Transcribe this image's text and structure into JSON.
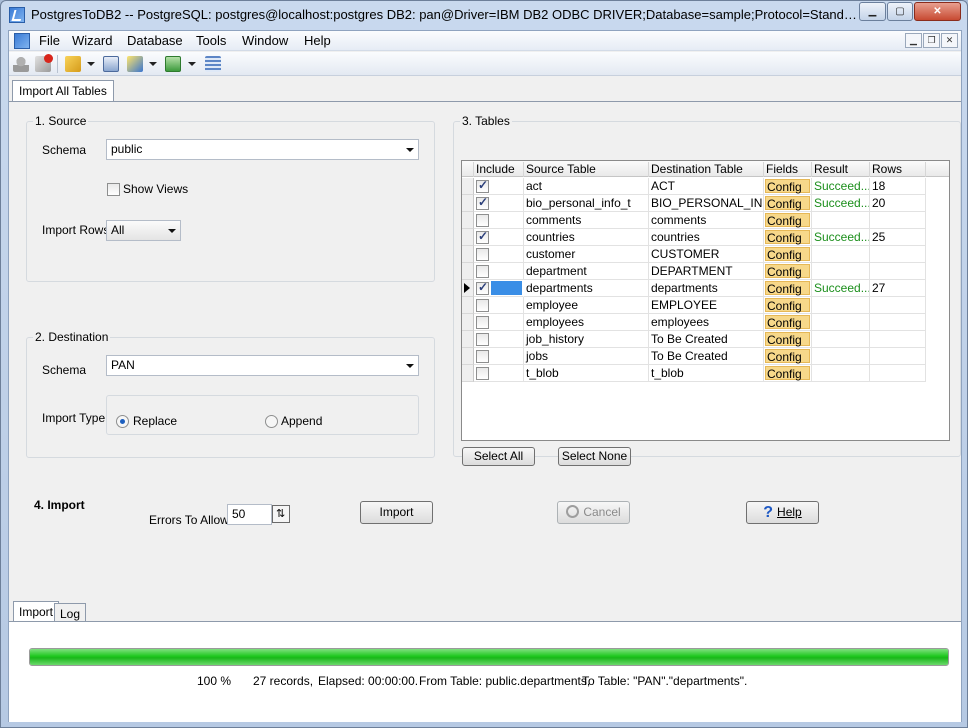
{
  "window": {
    "title": "PostgresToDB2 -- PostgreSQL: postgres@localhost:postgres DB2: pan@Driver=IBM DB2 ODBC DRIVER;Database=sample;Protocol=Standard;..."
  },
  "menu": [
    "File",
    "Wizard",
    "Database",
    "Tools",
    "Window",
    "Help"
  ],
  "doc_tab": "Import All Tables",
  "source": {
    "group_label": "1. Source",
    "schema_label": "Schema",
    "schema_value": "public",
    "show_views_label": "Show Views",
    "import_rows_label": "Import Rows",
    "import_rows_value": "All"
  },
  "destination": {
    "group_label": "2. Destination",
    "schema_label": "Schema",
    "schema_value": "PAN",
    "import_type_label": "Import Type",
    "replace_label": "Replace",
    "append_label": "Append"
  },
  "tables": {
    "group_label": "3. Tables",
    "columns": [
      "Include",
      "Source Table",
      "Destination Table",
      "Fields",
      "Result",
      "Rows"
    ],
    "rows": [
      {
        "include": true,
        "source": "act",
        "dest": "ACT",
        "fields": "Config",
        "result": "Succeed...",
        "rows": "18"
      },
      {
        "include": true,
        "source": "bio_personal_info_t",
        "dest": "BIO_PERSONAL_IN...",
        "fields": "Config",
        "result": "Succeed...",
        "rows": "20"
      },
      {
        "include": false,
        "source": "comments",
        "dest": "comments",
        "fields": "Config",
        "result": "",
        "rows": ""
      },
      {
        "include": true,
        "source": "countries",
        "dest": "countries",
        "fields": "Config",
        "result": "Succeed...",
        "rows": "25"
      },
      {
        "include": false,
        "source": "customer",
        "dest": "CUSTOMER",
        "fields": "Config",
        "result": "",
        "rows": ""
      },
      {
        "include": false,
        "source": "department",
        "dest": "DEPARTMENT",
        "fields": "Config",
        "result": "",
        "rows": ""
      },
      {
        "include": true,
        "source": "departments",
        "dest": "departments",
        "fields": "Config",
        "result": "Succeed...",
        "rows": "27"
      },
      {
        "include": false,
        "source": "employee",
        "dest": "EMPLOYEE",
        "fields": "Config",
        "result": "",
        "rows": ""
      },
      {
        "include": false,
        "source": "employees",
        "dest": "employees",
        "fields": "Config",
        "result": "",
        "rows": ""
      },
      {
        "include": false,
        "source": "job_history",
        "dest": "To Be Created",
        "fields": "Config",
        "result": "",
        "rows": ""
      },
      {
        "include": false,
        "source": "jobs",
        "dest": "To Be Created",
        "fields": "Config",
        "result": "",
        "rows": ""
      },
      {
        "include": false,
        "source": "t_blob",
        "dest": "t_blob",
        "fields": "Config",
        "result": "",
        "rows": ""
      }
    ],
    "select_all_label": "Select All",
    "select_none_label": "Select None"
  },
  "import": {
    "heading": "4. Import",
    "errors_label": "Errors To Allow",
    "errors_value": "50",
    "import_button": "Import",
    "cancel_button": "Cancel",
    "help_button": "Help"
  },
  "bottom_tabs": [
    "Import",
    "Log"
  ],
  "progress": {
    "percent_value": 100,
    "percent_text": "100 %",
    "records": "27 records,",
    "elapsed": "Elapsed: 00:00:00.",
    "from_table": "From Table: public.departments,",
    "to_table": "To Table: \"PAN\".\"departments\"."
  }
}
